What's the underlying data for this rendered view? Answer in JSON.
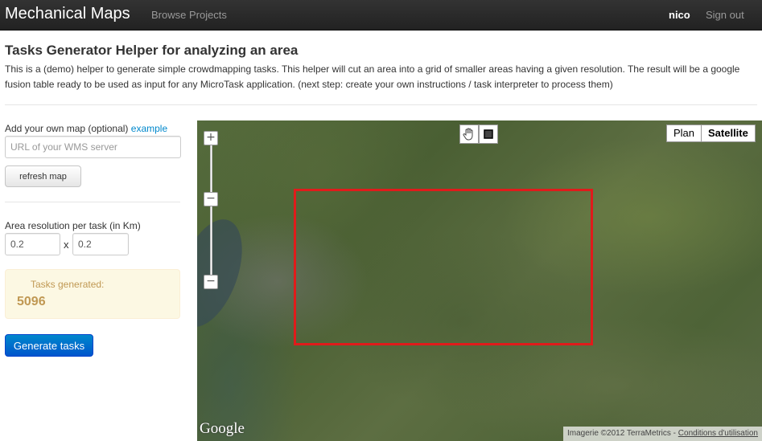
{
  "navbar": {
    "brand": "Mechanical Maps",
    "browse_label": "Browse Projects",
    "user": "nico",
    "signout_label": "Sign out"
  },
  "header": {
    "title": "Tasks Generator Helper for analyzing an area",
    "intro": "This is a (demo) helper to generate simple crowdmapping tasks. This helper will cut an area into a grid of smaller areas having a given resolution. The result will be a google fusion table ready to be used as input for any MicroTask application. (next step: create your own instructions / task interpreter to process them)"
  },
  "form": {
    "own_map_label": "Add your own map (optional)",
    "example_link": "example",
    "wms_placeholder": "URL of your WMS server",
    "refresh_label": "refresh map",
    "resolution_label": "Area resolution per task (in Km)",
    "res_x": "0.2",
    "times": "x",
    "res_y": "0.2",
    "tasks_generated_label": "Tasks generated:",
    "tasks_generated_count": "5096",
    "generate_label": "Generate tasks"
  },
  "map": {
    "zoom_in": "+",
    "zoom_out": "−",
    "zoom_min": "−",
    "type_plan": "Plan",
    "type_satellite": "Satellite",
    "logo": "Google",
    "attribution": "Imagerie ©2012 TerraMetrics - ",
    "terms_link": "Conditions d'utilisation",
    "selection_color": "#e01b1b"
  }
}
